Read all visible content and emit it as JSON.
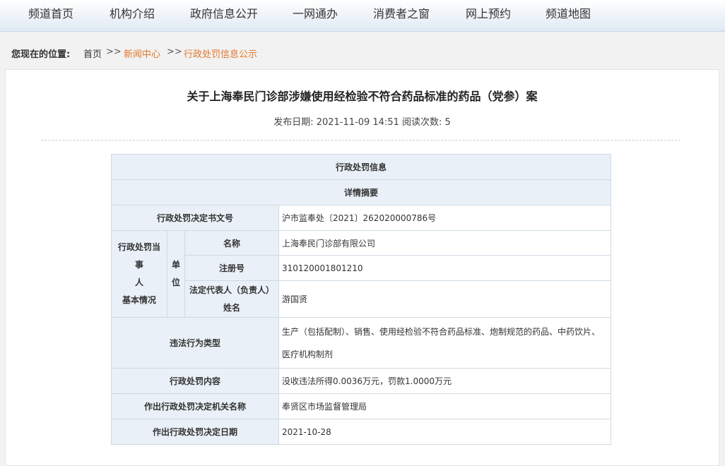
{
  "nav": [
    "频道首页",
    "机构介绍",
    "政府信息公开",
    "一网通办",
    "消费者之窗",
    "网上预约",
    "频道地图"
  ],
  "breadcrumb": {
    "lead": "您现在的位置:",
    "home": "首页",
    "sep": ">>",
    "news": "新闻中心",
    "current": "行政处罚信息公示"
  },
  "article": {
    "title": "关于上海奉民门诊部涉嫌使用经检验不符合药品标准的药品（党参）案",
    "meta": "发布日期: 2021-11-09 14:51  阅读次数: 5"
  },
  "table": {
    "header1": "行政处罚信息",
    "header2": "详情摘要",
    "doc_no_label": "行政处罚决定书文号",
    "doc_no": "沪市监奉处〔2021〕262020000786号",
    "party_label": [
      "行政处罚当事",
      "人",
      "基本情况"
    ],
    "unit_label": [
      "单",
      "位"
    ],
    "name_label": "名称",
    "name": "上海奉民门诊部有限公司",
    "reg_label": "注册号",
    "reg_no": "310120001801210",
    "rep_label": [
      "法定代表人（负责人）",
      "姓名"
    ],
    "rep": "游国贤",
    "violation_label": "违法行为类型",
    "violation": [
      "生产（包括配制）、销售、使用经检验不符合药品标准、炮制规范的药品、中药饮片、",
      "医疗机构制剂"
    ],
    "content_label": "行政处罚内容",
    "content": "没收违法所得0.0036万元，罚款1.0000万元",
    "org_label": "作出行政处罚决定机关名称",
    "org": "奉贤区市场监督管理局",
    "date_label": "作出行政处罚决定日期",
    "date": "2021-10-28"
  }
}
